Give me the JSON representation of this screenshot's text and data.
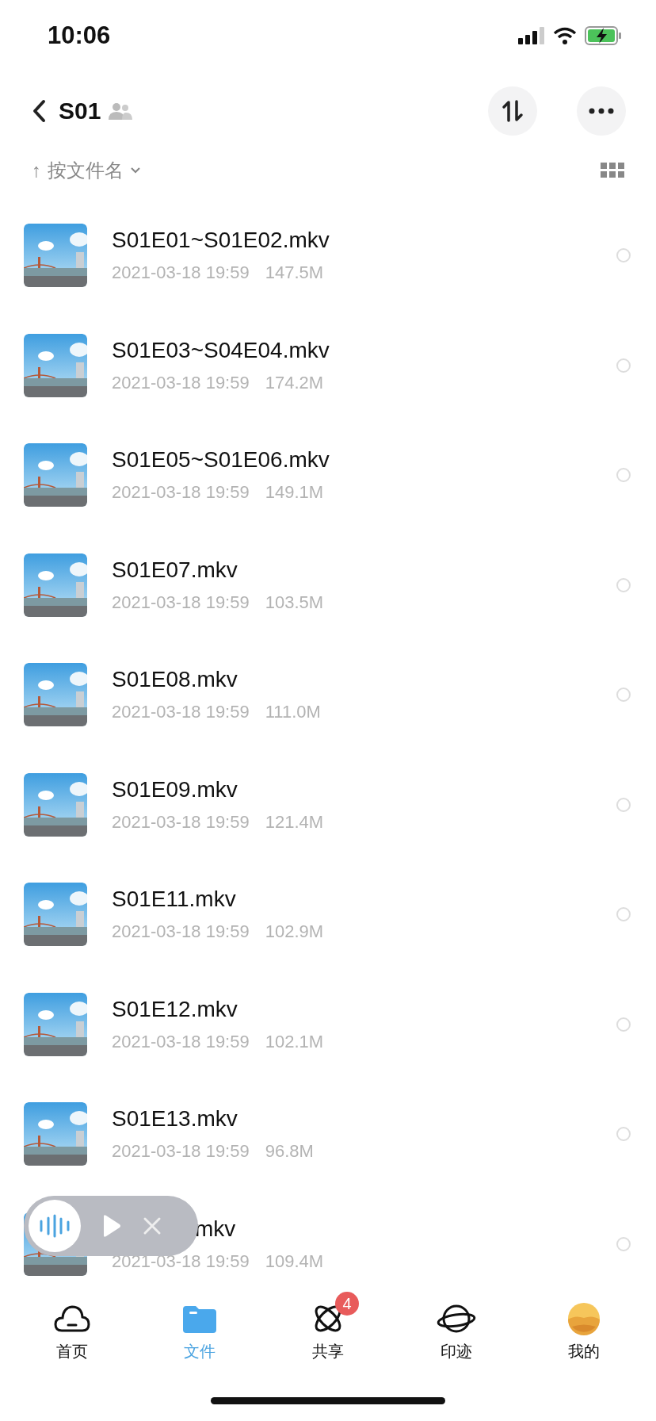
{
  "status_bar": {
    "time": "10:06"
  },
  "header": {
    "title": "S01"
  },
  "sort": {
    "arrow": "↑",
    "label": "按文件名"
  },
  "files": [
    {
      "name": "S01E01~S01E02.mkv",
      "date": "2021-03-18 19:59",
      "size": "147.5M",
      "selected": false
    },
    {
      "name": "S01E03~S04E04.mkv",
      "date": "2021-03-18 19:59",
      "size": "174.2M",
      "selected": false
    },
    {
      "name": "S01E05~S01E06.mkv",
      "date": "2021-03-18 19:59",
      "size": "149.1M",
      "selected": false
    },
    {
      "name": "S01E07.mkv",
      "date": "2021-03-18 19:59",
      "size": "103.5M",
      "selected": false
    },
    {
      "name": "S01E08.mkv",
      "date": "2021-03-18 19:59",
      "size": "111.0M",
      "selected": false
    },
    {
      "name": "S01E09.mkv",
      "date": "2021-03-18 19:59",
      "size": "121.4M",
      "selected": false
    },
    {
      "name": "S01E11.mkv",
      "date": "2021-03-18 19:59",
      "size": "102.9M",
      "selected": false
    },
    {
      "name": "S01E12.mkv",
      "date": "2021-03-18 19:59",
      "size": "102.1M",
      "selected": false
    },
    {
      "name": "S01E13.mkv",
      "date": "2021-03-18 19:59",
      "size": "96.8M",
      "selected": false
    },
    {
      "name": "mkv",
      "date": "2021-03-18 19:59",
      "size": "109.4M",
      "selected": false,
      "obscured": true
    }
  ],
  "tabs": [
    {
      "label": "首页",
      "kind": "cloud",
      "selected": false
    },
    {
      "label": "文件",
      "kind": "folder",
      "selected": true
    },
    {
      "label": "共享",
      "kind": "orbit",
      "selected": false,
      "badge": "4"
    },
    {
      "label": "印迹",
      "kind": "planet",
      "selected": false
    },
    {
      "label": "我的",
      "kind": "avatar",
      "selected": false
    }
  ]
}
